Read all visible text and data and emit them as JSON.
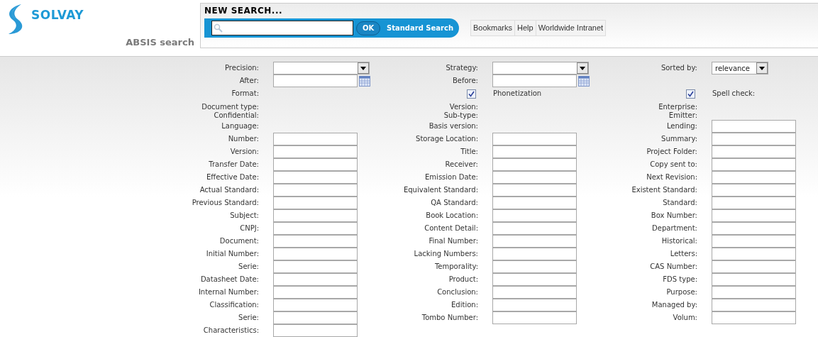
{
  "header": {
    "logo_text": "SOLVAY",
    "app_title": "ABSIS search",
    "panel_title": "NEW SEARCH...",
    "ok_button": "OK",
    "mode_label": "Standard Search",
    "links": [
      "Bookmarks",
      "Help",
      "Worldwide Intranet"
    ]
  },
  "form": {
    "rows": [
      {
        "cells": [
          {
            "kind": "select",
            "label": "Precision:"
          },
          {
            "kind": "select",
            "label": "Strategy:"
          },
          {
            "kind": "select_small",
            "label": "Sorted by:",
            "value": "relevance"
          }
        ]
      },
      {
        "cells": [
          {
            "kind": "date",
            "label": "After:"
          },
          {
            "kind": "date",
            "label": "Before:"
          },
          {
            "kind": "none"
          }
        ]
      },
      {
        "cells": [
          {
            "kind": "label",
            "label": "Format:"
          },
          {
            "kind": "check",
            "checked": true,
            "label": "Phonetization"
          },
          {
            "kind": "check",
            "checked": true,
            "label": "Spell check:"
          }
        ]
      },
      {
        "cells": [
          {
            "kind": "label",
            "label": "Document type:"
          },
          {
            "kind": "label",
            "label": "Version:"
          },
          {
            "kind": "label",
            "label": "Enterprise:"
          }
        ]
      },
      {
        "cells": [
          {
            "kind": "label",
            "label": "Confidential:"
          },
          {
            "kind": "label",
            "label": "Sub-type:"
          },
          {
            "kind": "label",
            "label": "Emitter:"
          }
        ]
      },
      {
        "cells": [
          {
            "kind": "label",
            "label": "Language:"
          },
          {
            "kind": "label",
            "label": "Basis version:"
          },
          {
            "kind": "text",
            "label": "Lending:"
          }
        ]
      },
      {
        "cells": [
          {
            "kind": "text",
            "label": "Number:"
          },
          {
            "kind": "text",
            "label": "Storage Location:"
          },
          {
            "kind": "text",
            "label": "Summary:"
          }
        ]
      },
      {
        "cells": [
          {
            "kind": "text",
            "label": "Version:"
          },
          {
            "kind": "text",
            "label": "Title:"
          },
          {
            "kind": "text",
            "label": "Project Folder:"
          }
        ]
      },
      {
        "cells": [
          {
            "kind": "text",
            "label": "Transfer Date:"
          },
          {
            "kind": "text",
            "label": "Receiver:"
          },
          {
            "kind": "text",
            "label": "Copy sent to:"
          }
        ]
      },
      {
        "cells": [
          {
            "kind": "text",
            "label": "Effective Date:"
          },
          {
            "kind": "text",
            "label": "Emission Date:"
          },
          {
            "kind": "text",
            "label": "Next Revision:"
          }
        ]
      },
      {
        "cells": [
          {
            "kind": "text",
            "label": "Actual Standard:"
          },
          {
            "kind": "text",
            "label": "Equivalent Standard:"
          },
          {
            "kind": "text",
            "label": "Existent Standard:"
          }
        ]
      },
      {
        "cells": [
          {
            "kind": "text",
            "label": "Previous Standard:"
          },
          {
            "kind": "text",
            "label": "QA Standard:"
          },
          {
            "kind": "text",
            "label": "Standard:"
          }
        ]
      },
      {
        "cells": [
          {
            "kind": "text",
            "label": "Subject:"
          },
          {
            "kind": "text",
            "label": "Book Location:"
          },
          {
            "kind": "text",
            "label": "Box Number:"
          }
        ]
      },
      {
        "cells": [
          {
            "kind": "text",
            "label": "CNPJ:"
          },
          {
            "kind": "text",
            "label": "Content Detail:"
          },
          {
            "kind": "text",
            "label": "Department:"
          }
        ]
      },
      {
        "cells": [
          {
            "kind": "text",
            "label": "Document:"
          },
          {
            "kind": "text",
            "label": "Final Number:"
          },
          {
            "kind": "text",
            "label": "Historical:"
          }
        ]
      },
      {
        "cells": [
          {
            "kind": "text",
            "label": "Initial Number:"
          },
          {
            "kind": "text",
            "label": "Lacking Numbers:"
          },
          {
            "kind": "text",
            "label": "Letters:"
          }
        ]
      },
      {
        "cells": [
          {
            "kind": "text",
            "label": "Serie:"
          },
          {
            "kind": "text",
            "label": "Temporality:"
          },
          {
            "kind": "text",
            "label": "CAS Number:"
          }
        ]
      },
      {
        "cells": [
          {
            "kind": "text",
            "label": "Datasheet Date:"
          },
          {
            "kind": "text",
            "label": "Product:"
          },
          {
            "kind": "text",
            "label": "FDS type:"
          }
        ]
      },
      {
        "cells": [
          {
            "kind": "text",
            "label": "Internal Number:"
          },
          {
            "kind": "text",
            "label": "Conclusion:"
          },
          {
            "kind": "text",
            "label": "Purpose:"
          }
        ]
      },
      {
        "cells": [
          {
            "kind": "text",
            "label": "Classification:"
          },
          {
            "kind": "text",
            "label": "Edition:"
          },
          {
            "kind": "text",
            "label": "Managed by:"
          }
        ]
      },
      {
        "cells": [
          {
            "kind": "text",
            "label": "Serie:"
          },
          {
            "kind": "text",
            "label": "Tombo Number:"
          },
          {
            "kind": "text",
            "label": "Volum:"
          }
        ]
      },
      {
        "cells": [
          {
            "kind": "text",
            "label": "Characteristics:"
          },
          {
            "kind": "none"
          },
          {
            "kind": "none"
          }
        ]
      }
    ]
  }
}
